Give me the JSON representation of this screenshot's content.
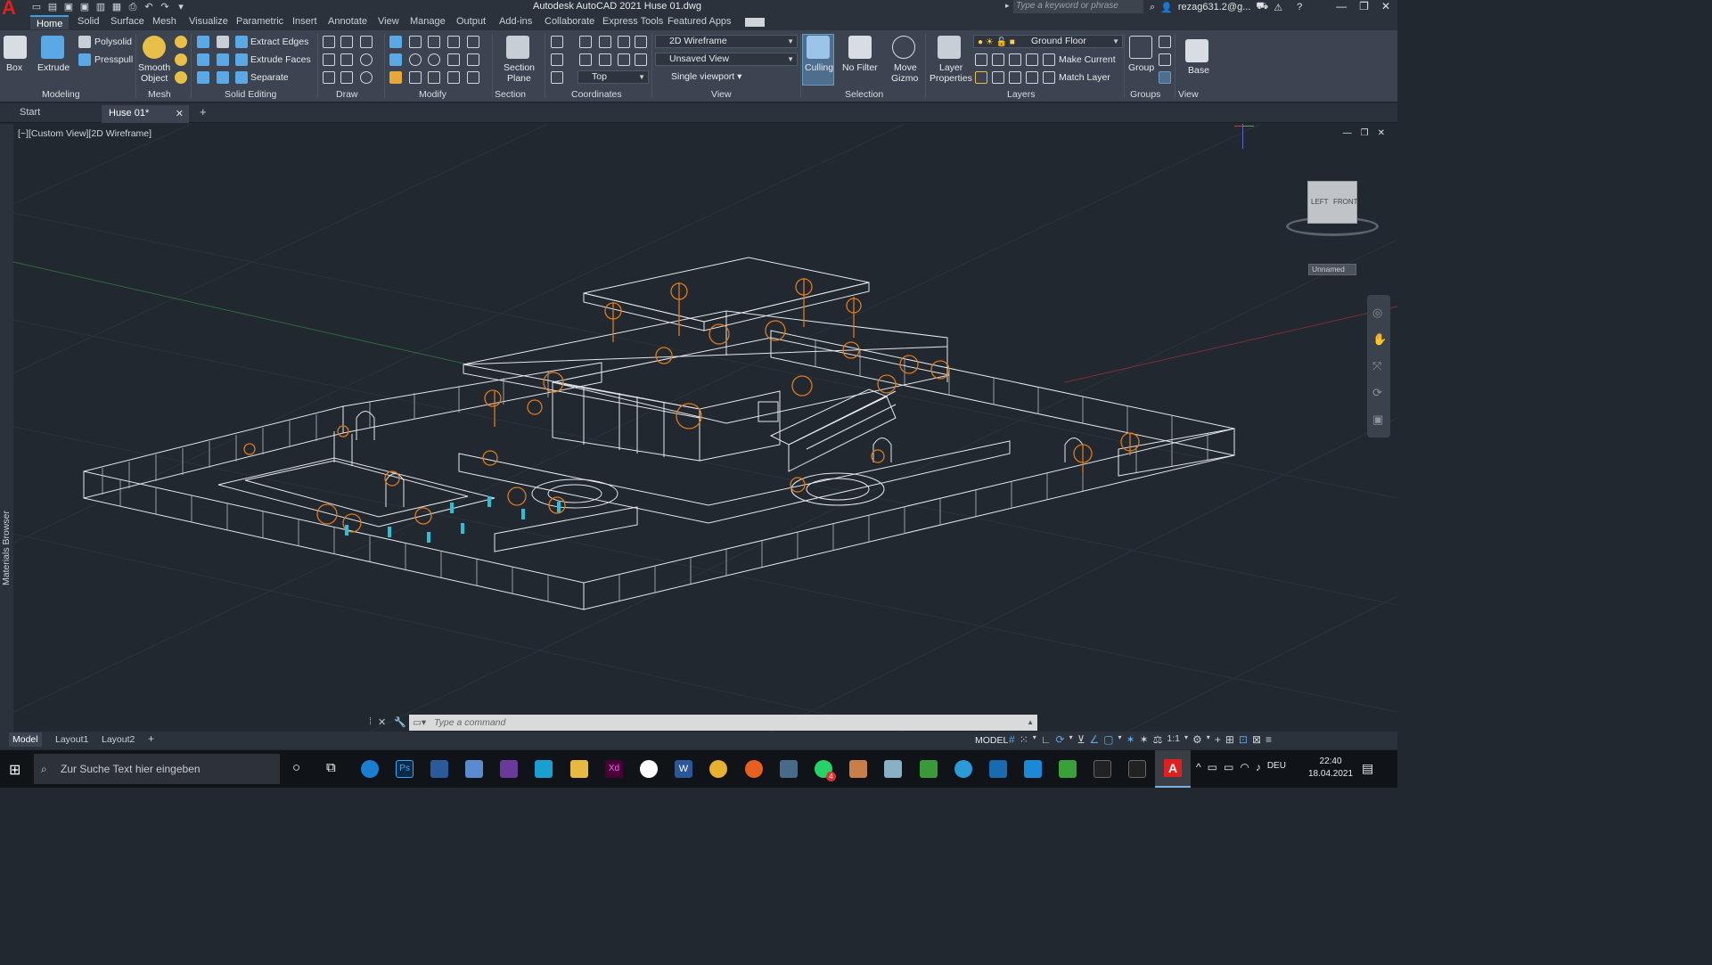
{
  "title": {
    "app_title": "Autodesk AutoCAD 2021    Huse 01.dwg",
    "search_placeholder": "Type a keyword or phrase",
    "user": "rezag631.2@g..."
  },
  "ribbon_tabs": [
    "Home",
    "Solid",
    "Surface",
    "Mesh",
    "Visualize",
    "Parametric",
    "Insert",
    "Annotate",
    "View",
    "Manage",
    "Output",
    "Add-ins",
    "Collaborate",
    "Express Tools",
    "Featured Apps"
  ],
  "ribbon": {
    "box": "Box",
    "extrude": "Extrude",
    "polysolid": "Polysolid",
    "presspull": "Presspull",
    "smooth_object_1": "Smooth",
    "smooth_object_2": "Object",
    "extract_edges": "Extract Edges",
    "extrude_faces": "Extrude Faces",
    "separate": "Separate",
    "section_plane_1": "Section",
    "section_plane_2": "Plane",
    "visual_style": "2D Wireframe",
    "saved_view": "Unsaved View",
    "view_direction": "Top",
    "single_viewport": "Single viewport",
    "culling": "Culling",
    "no_filter": "No Filter",
    "move_gizmo_1": "Move",
    "move_gizmo_2": "Gizmo",
    "layer_props_1": "Layer",
    "layer_props_2": "Properties",
    "current_layer": "Ground Floor",
    "make_current": "Make Current",
    "match_layer": "Match Layer",
    "group": "Group",
    "base": "Base"
  },
  "panel_titles": {
    "modeling": "Modeling",
    "mesh": "Mesh",
    "solid_editing": "Solid Editing",
    "draw": "Draw",
    "modify": "Modify",
    "section": "Section",
    "coordinates": "Coordinates",
    "view": "View",
    "selection": "Selection",
    "layers": "Layers",
    "groups": "Groups",
    "view2": "View"
  },
  "doc_tabs": {
    "start": "Start",
    "active": "Huse 01*"
  },
  "viewport": {
    "label": "[−][Custom View][2D Wireframe]",
    "viewcube_left": "LEFT",
    "viewcube_front": "FRONT",
    "ucs_name": "Unnamed",
    "side_panel": "Materials Browser"
  },
  "command": {
    "placeholder": "Type a command"
  },
  "layout_tabs": [
    "Model",
    "Layout1",
    "Layout2"
  ],
  "status": {
    "model": "MODEL",
    "scale": "1:1"
  },
  "taskbar": {
    "search_placeholder": "Zur Suche Text hier eingeben",
    "language": "DEU",
    "time": "22:40",
    "date": "18.04.2021",
    "whatsapp_badge": "4"
  },
  "colors": {
    "accent": "#3aa0e0",
    "model_orange": "#e07a1a",
    "wire_white": "#e6e8ea",
    "background": "#212830"
  }
}
